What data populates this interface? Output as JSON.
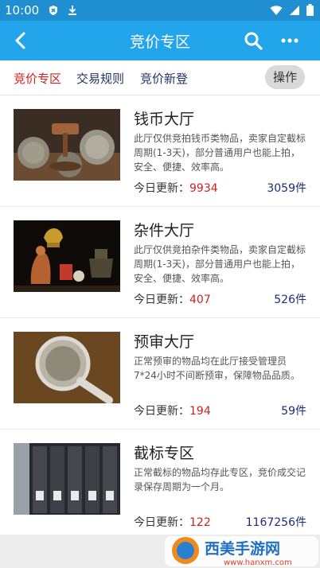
{
  "status": {
    "time": "10:00"
  },
  "appbar": {
    "title": "竞价专区"
  },
  "tabs": [
    {
      "label": "竞价专区",
      "active": true
    },
    {
      "label": "交易规则",
      "active": false
    },
    {
      "label": "竞价新登",
      "active": false
    }
  ],
  "actions": {
    "operate_label": "操作"
  },
  "items": [
    {
      "title": "钱币大厅",
      "desc": "此厅仅供竞拍钱币类物品，卖家自定截标周期(1-3天)，部分普通用户也能上拍，安全、便捷、效率高。",
      "update_label": "今日更新：",
      "update_value": "9934",
      "count": "3059件"
    },
    {
      "title": "杂件大厅",
      "desc": "此厅仅供竞拍杂件类物品，卖家自定截标周期(1-3天)，部分普通用户也能上拍，安全、便捷、效率高。",
      "update_label": "今日更新：",
      "update_value": "407",
      "count": "526件"
    },
    {
      "title": "预审大厅",
      "desc": "正常预审的物品均在此厅接受管理员7*24小时不间断预审，保障物品品质。",
      "update_label": "今日更新：",
      "update_value": "194",
      "count": "59件"
    },
    {
      "title": "截标专区",
      "desc": "正常截标的物品均存此专区，竞价成交记录保存周期为一个月。",
      "update_label": "今日更新：",
      "update_value": "122",
      "count": "1167256件"
    }
  ],
  "watermark": {
    "text": "西美手游网",
    "url": "www.hanxm.com"
  },
  "colors": {
    "accent": "#22a5eb",
    "red": "#d22020",
    "navy": "#1f2a7a"
  }
}
